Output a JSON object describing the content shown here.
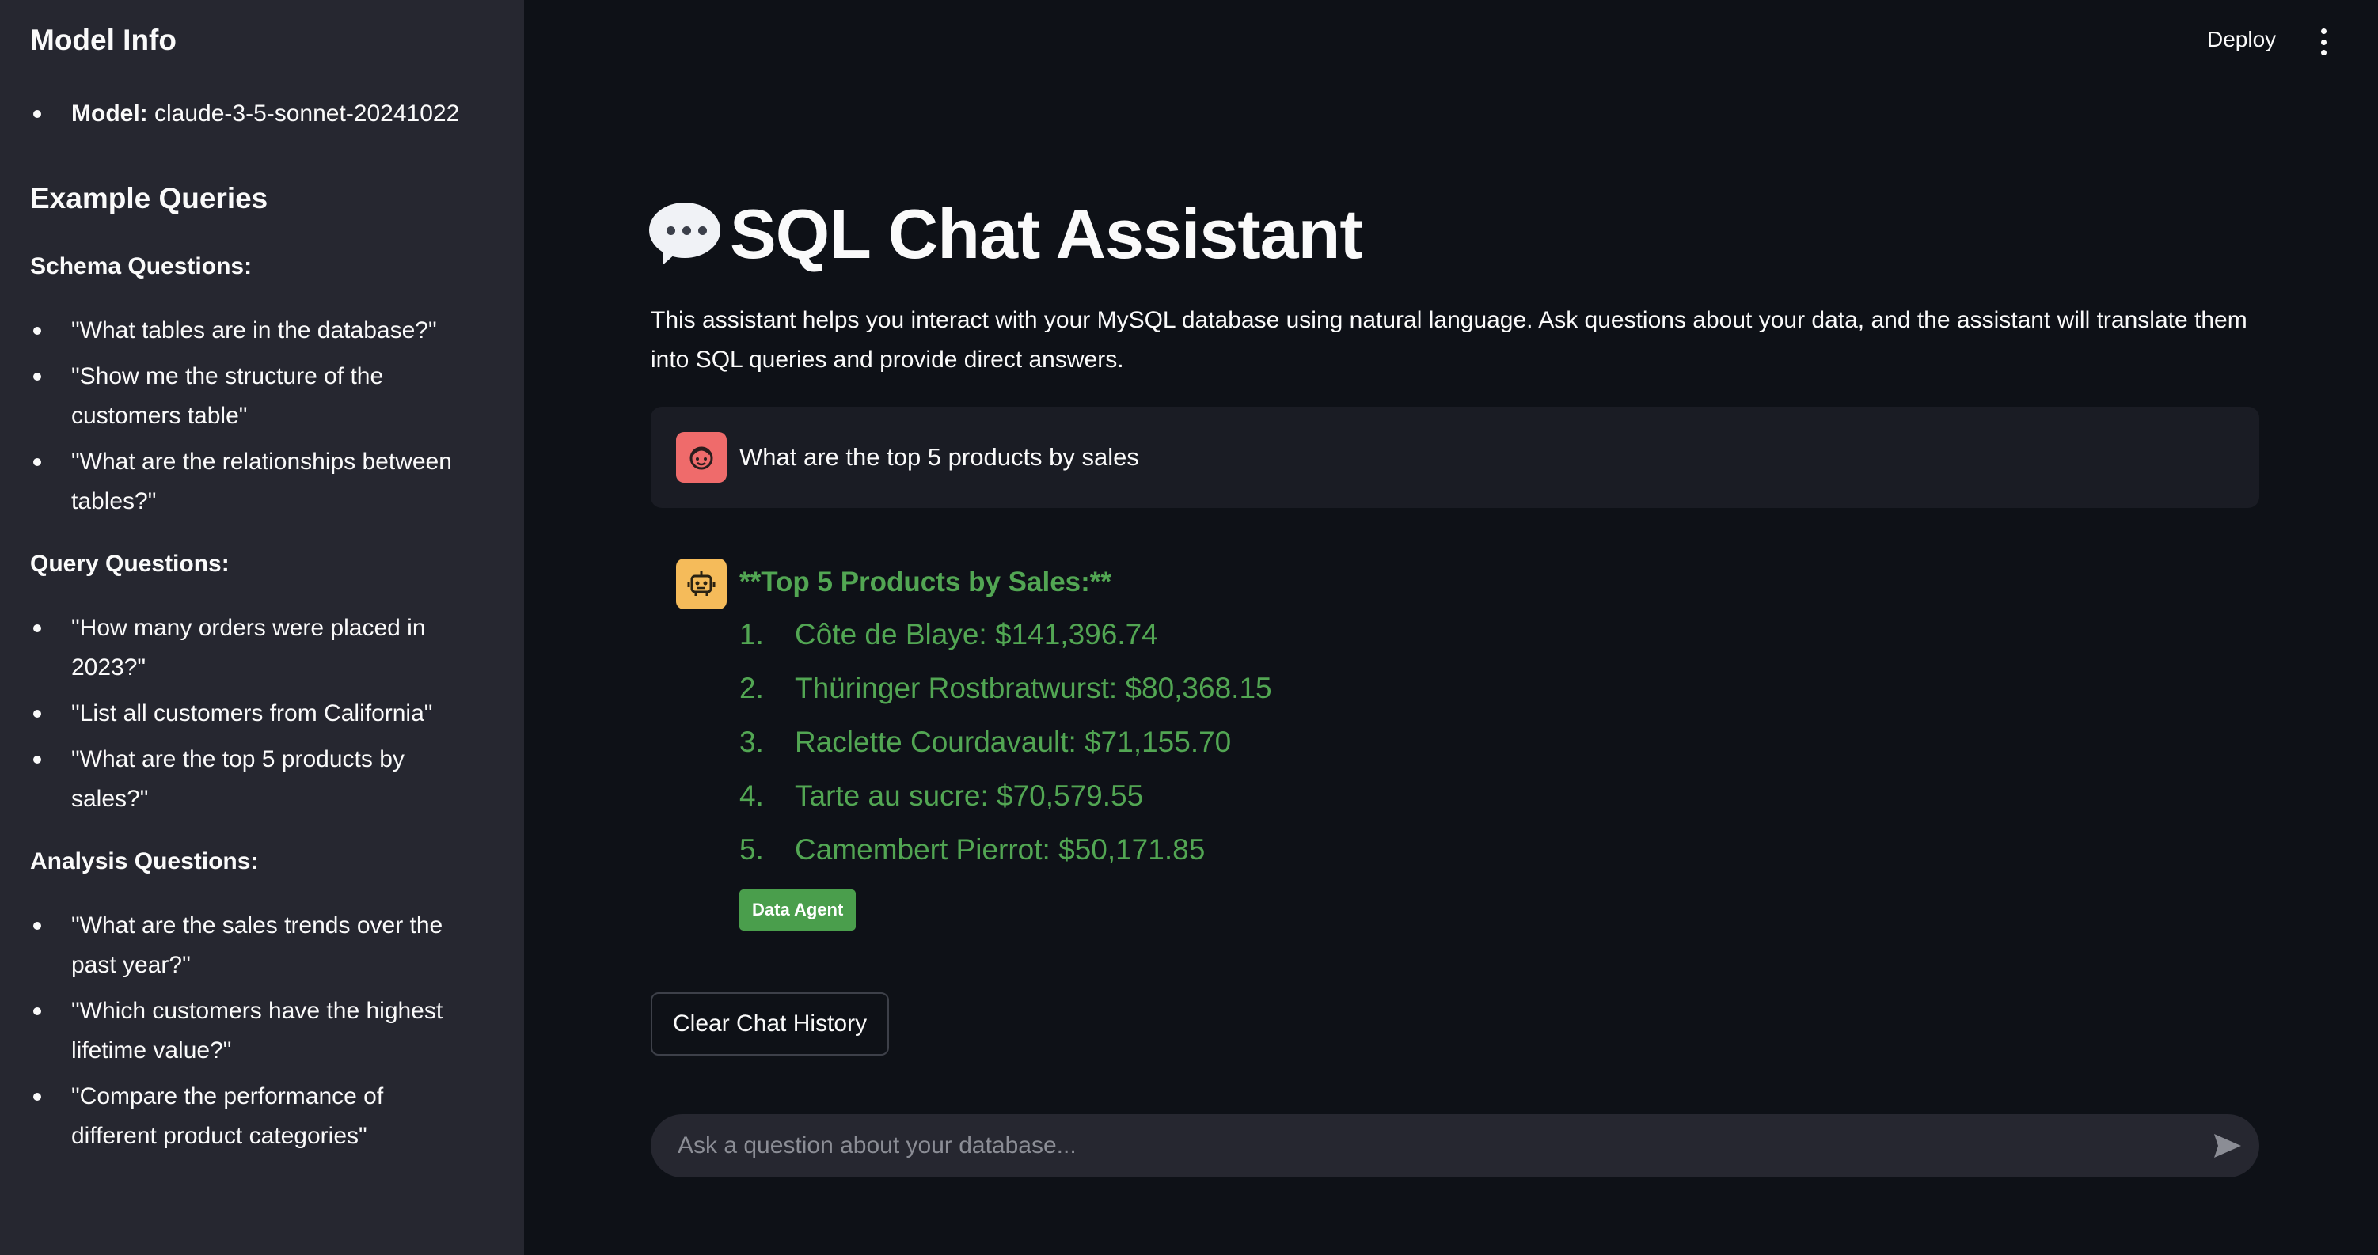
{
  "header": {
    "deploy_label": "Deploy",
    "menu_icon": "kebab-menu-icon"
  },
  "sidebar": {
    "model_info_title": "Model Info",
    "model_label": "Model:",
    "model_value": "claude-3-5-sonnet-20241022",
    "examples_title": "Example Queries",
    "sections": [
      {
        "title": "Schema Questions:",
        "items": [
          "\"What tables are in the database?\"",
          "\"Show me the structure of the customers table\"",
          "\"What are the relationships between tables?\""
        ]
      },
      {
        "title": "Query Questions:",
        "items": [
          "\"How many orders were placed in 2023?\"",
          "\"List all customers from California\"",
          "\"What are the top 5 products by sales?\""
        ]
      },
      {
        "title": "Analysis Questions:",
        "items": [
          "\"What are the sales trends over the past year?\"",
          "\"Which customers have the highest lifetime value?\"",
          "\"Compare the performance of different product categories\""
        ]
      }
    ]
  },
  "main": {
    "title": "SQL Chat Assistant",
    "title_icon": "speech-bubble-icon",
    "description": "This assistant helps you interact with your MySQL database using natural language. Ask questions about your data, and the assistant will translate them into SQL queries and provide direct answers.",
    "messages": {
      "user": {
        "avatar_icon": "user-face-icon",
        "text": "What are the top 5 products by sales"
      },
      "assistant": {
        "avatar_icon": "robot-icon",
        "heading": "**Top 5 Products by Sales:**",
        "items": [
          {
            "num": "1.",
            "text": "Côte de Blaye: $141,396.74"
          },
          {
            "num": "2.",
            "text": "Thüringer Rostbratwurst: $80,368.15"
          },
          {
            "num": "3.",
            "text": "Raclette Courdavault: $71,155.70"
          },
          {
            "num": "4.",
            "text": "Tarte au sucre: $70,579.55"
          },
          {
            "num": "5.",
            "text": "Camembert Pierrot: $50,171.85"
          }
        ],
        "badge": "Data Agent"
      }
    },
    "clear_button_label": "Clear Chat History",
    "chat_input": {
      "placeholder": "Ask a question about your database...",
      "value": ""
    }
  },
  "colors": {
    "background": "#0e1117",
    "sidebar": "#262730",
    "assistant_text": "#52a653",
    "badge": "#4a9e4c",
    "user_avatar": "#ef6b6b",
    "bot_avatar": "#f5bb5a"
  }
}
